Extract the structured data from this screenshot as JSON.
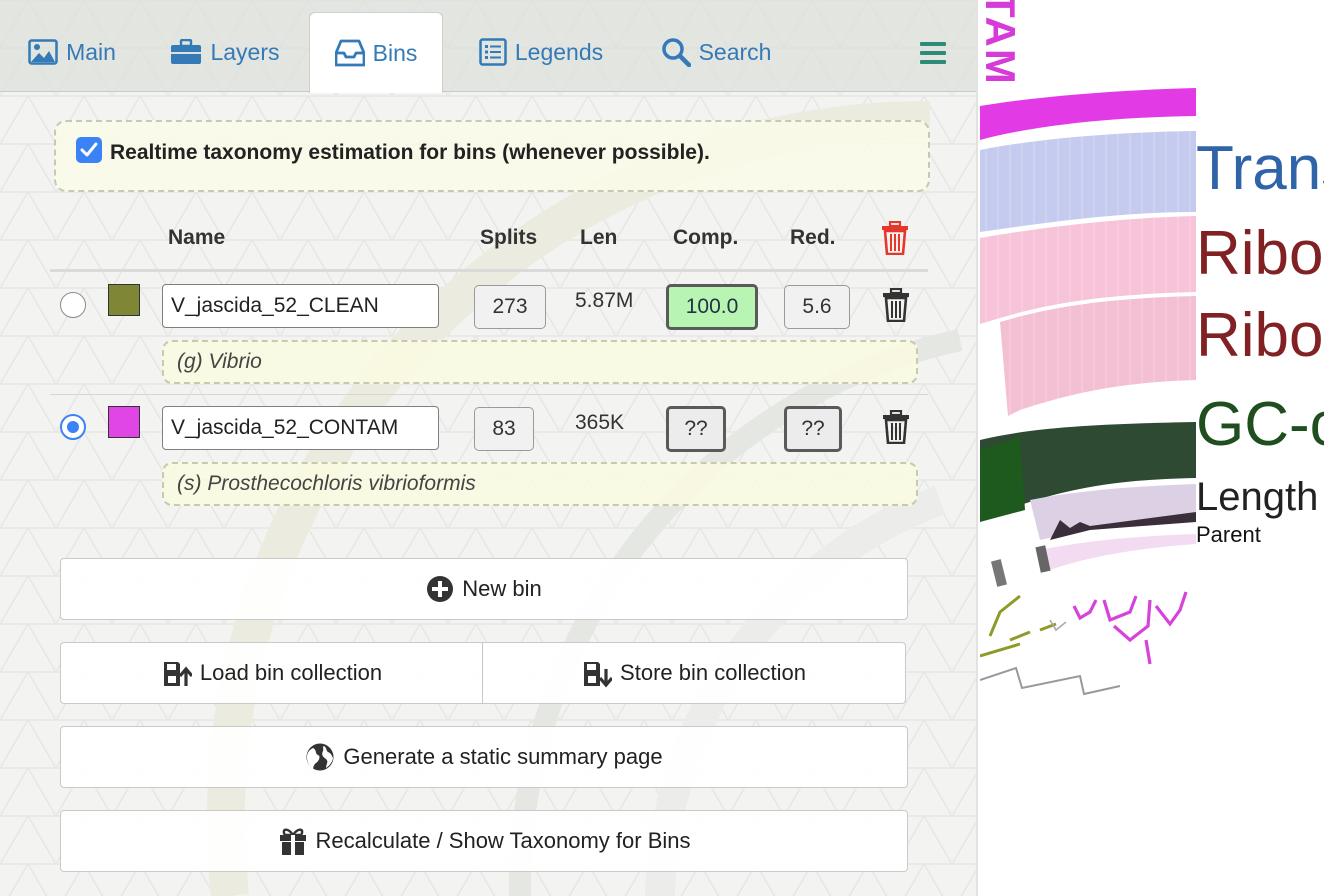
{
  "tabs": [
    {
      "label": "Main",
      "icon": "image-icon"
    },
    {
      "label": "Layers",
      "icon": "briefcase-icon"
    },
    {
      "label": "Bins",
      "icon": "inbox-icon",
      "active": true
    },
    {
      "label": "Legends",
      "icon": "list-icon"
    },
    {
      "label": "Search",
      "icon": "search-icon"
    }
  ],
  "menu_icon": "hamburger-icon",
  "taxonomy_option": {
    "label": "Realtime taxonomy estimation for bins (whenever possible).",
    "checked": true
  },
  "table": {
    "headers": {
      "name": "Name",
      "splits": "Splits",
      "len": "Len",
      "comp": "Comp.",
      "red": "Red."
    },
    "rows": [
      {
        "selected": false,
        "color": "#7f8635",
        "name": "V_jascida_52_CLEAN",
        "splits": "273",
        "len": "5.87M",
        "comp": "100.0",
        "red": "5.6",
        "taxonomy": "(g) Vibrio"
      },
      {
        "selected": true,
        "color": "#e046e6",
        "name": "V_jascida_52_CONTAM",
        "splits": "83",
        "len": "365K",
        "comp": "??",
        "red": "??",
        "taxonomy": "(s) Prosthecochloris vibrioformis"
      }
    ]
  },
  "buttons": {
    "new_bin": "New bin",
    "load": "Load bin collection",
    "store": "Store bin collection",
    "summary": "Generate a static summary page",
    "recalc": "Recalculate / Show Taxonomy for Bins"
  },
  "viz": {
    "bin_label_fragment": "TAM",
    "layer_labels": [
      {
        "text": "Trans",
        "color": "#2f64a8"
      },
      {
        "text": "Ribos",
        "color": "#822124"
      },
      {
        "text": "Ribos",
        "color": "#822124"
      },
      {
        "text": "GC-c",
        "color": "#1f4f1f"
      },
      {
        "text": "Length",
        "color": "#222222"
      },
      {
        "text": "Parent",
        "color": "#111111"
      }
    ]
  },
  "colors": {
    "accent": "#337ab7",
    "danger": "#e5372b",
    "checkbox": "#3b82f6"
  }
}
